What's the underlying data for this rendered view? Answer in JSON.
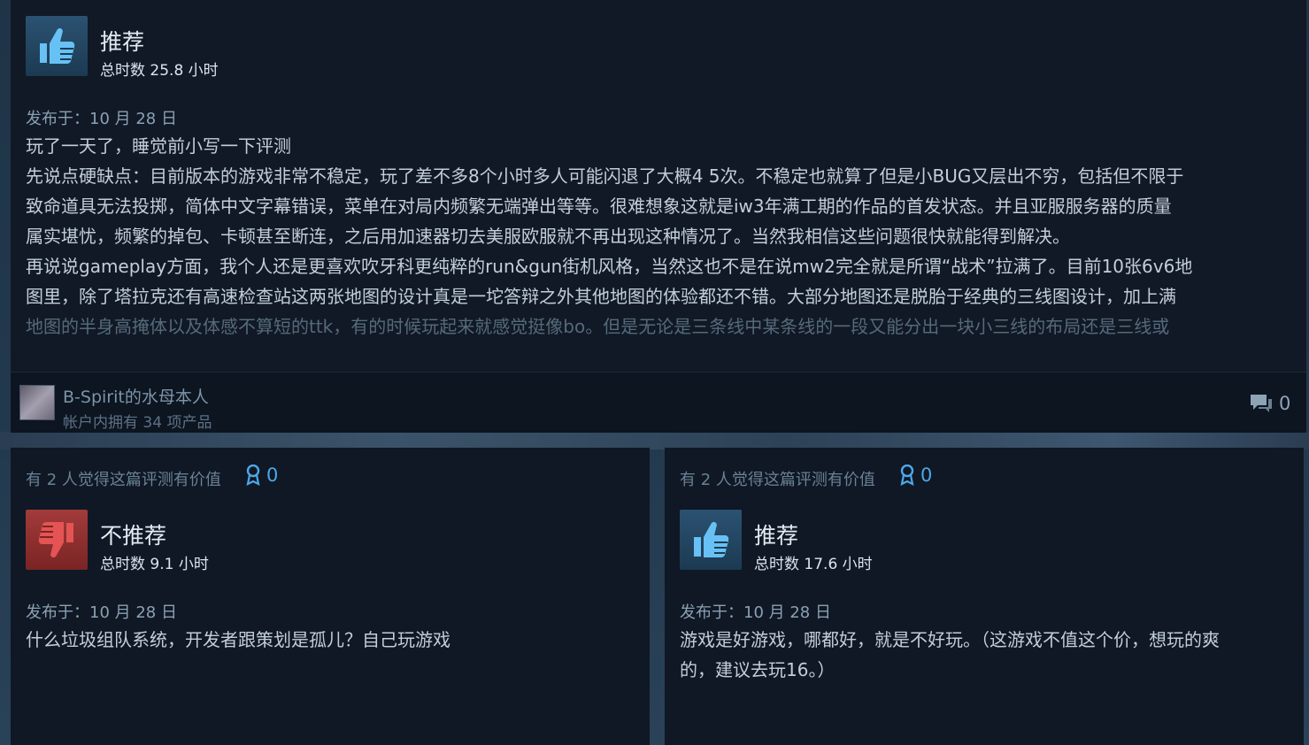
{
  "review_top": {
    "verdict": "推荐",
    "hours": "总时数 25.8 小时",
    "posted": "发布于：10 月 28 日",
    "lines": [
      "玩了一天了，睡觉前小写一下评测",
      "先说点硬缺点：目前版本的游戏非常不稳定，玩了差不多8个小时多人可能闪退了大概4 5次。不稳定也就算了但是小BUG又层出不穷，包括但不限于",
      "致命道具无法投掷，简体中文字幕错误，菜单在对局内频繁无端弹出等等。很难想象这就是iw3年满工期的作品的首发状态。并且亚服服务器的质量",
      "属实堪忧，频繁的掉包、卡顿甚至断连，之后用加速器切去美服欧服就不再出现这种情况了。当然我相信这些问题很快就能得到解决。",
      "再说说gameplay方面，我个人还是更喜欢吹牙科更纯粹的run&gun街机风格，当然这也不是在说mw2完全就是所谓“战术”拉满了。目前10张6v6地",
      "图里，除了塔拉克还有高速检查站这两张地图的设计真是一坨答辩之外其他地图的体验都还不错。大部分地图还是脱胎于经典的三线图设计，加上满",
      "地图的半身高掩体以及体感不算短的ttk，有的时候玩起来就感觉挺像bo。但是无论是三条线中某条线的一段又能分出一块小三线的布局还是三线或"
    ],
    "author": {
      "name": "B-Spirit的水母本人",
      "games": "帐户内拥有 34 项产品"
    },
    "comments": "0"
  },
  "review_left": {
    "helpful": "有 2 人觉得这篇评测有价值",
    "awards": "0",
    "verdict": "不推荐",
    "hours": "总时数 9.1 小时",
    "posted": "发布于：10 月 28 日",
    "lines": [
      "什么垃圾组队系统，开发者跟策划是孤儿？自己玩游戏"
    ]
  },
  "review_right": {
    "helpful": "有 2 人觉得这篇评测有价值",
    "awards": "0",
    "verdict": "推荐",
    "hours": "总时数 17.6 小时",
    "posted": "发布于：10 月 28 日",
    "lines": [
      "游戏是好游戏，哪都好，就是不好玩。（这游戏不值这个价，想玩的爽",
      "的，建议去玩16。）"
    ]
  },
  "icons": {
    "recommend": "thumbs-up-icon",
    "not_recommend": "thumbs-down-icon",
    "award": "award-ribbon-icon",
    "comment": "comment-bubble-icon"
  },
  "colors": {
    "recommend_bg": "#2b5272",
    "not_recommend_bg": "#a33b3b",
    "award_blue": "#4ea7e8"
  }
}
